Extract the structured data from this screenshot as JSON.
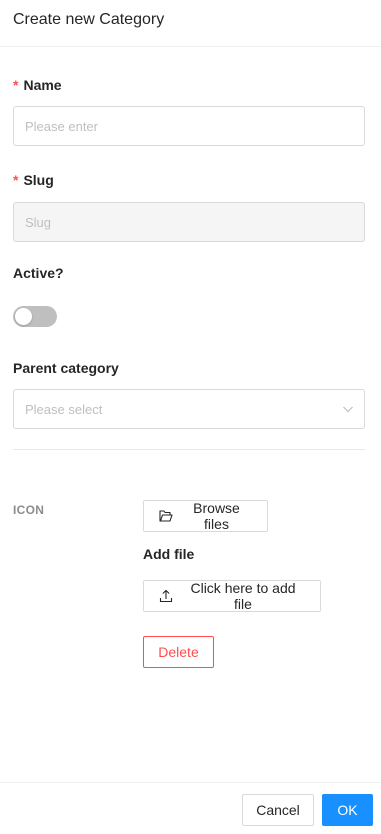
{
  "header": {
    "title": "Create new Category"
  },
  "form": {
    "name": {
      "label": "Name",
      "required_mark": "*",
      "placeholder": "Please enter",
      "value": ""
    },
    "slug": {
      "label": "Slug",
      "required_mark": "*",
      "placeholder": "Slug",
      "value": ""
    },
    "active": {
      "label": "Active?",
      "checked": false
    },
    "parent": {
      "label": "Parent category",
      "placeholder": "Please select"
    }
  },
  "icon_section": {
    "label": "ICON",
    "browse_label": "Browse files",
    "add_file_heading": "Add file",
    "add_file_button": "Click here to add file",
    "delete_label": "Delete"
  },
  "footer": {
    "cancel_label": "Cancel",
    "ok_label": "OK"
  },
  "colors": {
    "primary": "#1890ff",
    "danger": "#ff4d4f",
    "toggle_off": "#bfbfbf"
  },
  "icons": [
    "folder-open-icon",
    "upload-icon",
    "chevron-down-icon"
  ]
}
